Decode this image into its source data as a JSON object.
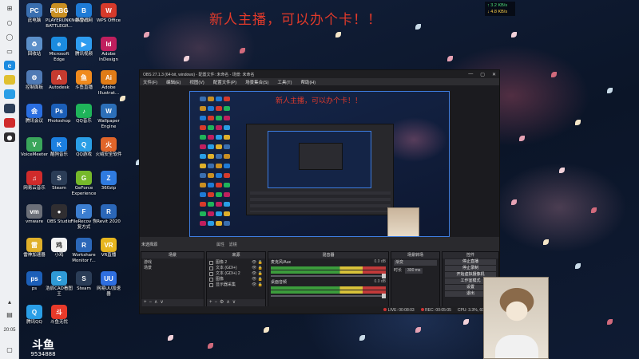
{
  "headline": "新人主播，可以办个卡！！",
  "net_speed": {
    "up": "↑ 3.2 KB/s",
    "down": "↓ 4.8 KB/s"
  },
  "taskbar": {
    "icons": [
      "windows-icon",
      "search-icon",
      "cortana-icon",
      "task-view-icon",
      "edge-icon",
      "chrome-icon",
      "qq-icon",
      "steam-icon",
      "netease-music-icon",
      "obs-icon"
    ],
    "clock": "20:05"
  },
  "desktop_icons": [
    {
      "label": "此电脑",
      "glyph": "PC",
      "color": "#3a6fb0"
    },
    {
      "label": "PLAYERUNKNOWN'S BATTLEGR...",
      "glyph": "PUBG",
      "color": "#c98f22"
    },
    {
      "label": "暴雪战网",
      "glyph": "B",
      "color": "#1e7bd6"
    },
    {
      "label": "WPS Office",
      "glyph": "W",
      "color": "#d63a2b"
    },
    {
      "label": "回收站",
      "glyph": "♻",
      "color": "#5b8fc9"
    },
    {
      "label": "Microsoft Edge",
      "glyph": "e",
      "color": "#1b8be0"
    },
    {
      "label": "腾讯视频",
      "glyph": "▶",
      "color": "#2e9cf0"
    },
    {
      "label": "Adobe InDesign",
      "glyph": "Id",
      "color": "#c01f5e"
    },
    {
      "label": "控制面板",
      "glyph": "⚙",
      "color": "#4f7ab5"
    },
    {
      "label": "Autodesk",
      "glyph": "A",
      "color": "#c63b2f"
    },
    {
      "label": "斗鱼直播",
      "glyph": "鱼",
      "color": "#f08a1d"
    },
    {
      "label": "Adobe Illustrat...",
      "glyph": "Ai",
      "color": "#e07c17"
    },
    {
      "label": "腾讯会议",
      "glyph": "会",
      "color": "#2a6ee0"
    },
    {
      "label": "Photoshop",
      "glyph": "Ps",
      "color": "#1c5fb8"
    },
    {
      "label": "QQ音乐",
      "glyph": "♪",
      "color": "#1fb45a"
    },
    {
      "label": "Wallpaper Engine",
      "glyph": "W",
      "color": "#2c6fb8"
    },
    {
      "label": "VoiceMeeter",
      "glyph": "V",
      "color": "#3aa65b"
    },
    {
      "label": "酷狗音乐",
      "glyph": "K",
      "color": "#1b7fe0"
    },
    {
      "label": "QQ游戏",
      "glyph": "Q",
      "color": "#2a9ee6"
    },
    {
      "label": "火绒安全软件",
      "glyph": "火",
      "color": "#e0652a"
    },
    {
      "label": "网易云音乐",
      "glyph": "♫",
      "color": "#d02b2b"
    },
    {
      "label": "Steam",
      "glyph": "S",
      "color": "#2b3d57"
    },
    {
      "label": "GeForce Experience",
      "glyph": "G",
      "color": "#76b82a"
    },
    {
      "label": "360zip",
      "glyph": "Z",
      "color": "#2f7be0"
    },
    {
      "label": "vmware",
      "glyph": "vm",
      "color": "#6b6f78"
    },
    {
      "label": "OBS Studio",
      "glyph": "●",
      "color": "#302e31"
    },
    {
      "label": "FileRecov 恢复方式",
      "glyph": "F",
      "color": "#3c7ed0"
    },
    {
      "label": "Revit 2020",
      "glyph": "R",
      "color": "#2b67b8"
    },
    {
      "label": "雷神加速器",
      "glyph": "雷",
      "color": "#e0b02a"
    },
    {
      "label": "小鸡",
      "glyph": "鸡",
      "color": "#f2f2f2"
    },
    {
      "label": "Workshare Monitor f...",
      "glyph": "R",
      "color": "#2b67b8"
    },
    {
      "label": "VR直播",
      "glyph": "VR",
      "color": "#e6b51e"
    },
    {
      "label": "ps",
      "glyph": "ps",
      "color": "#1c5fb8"
    },
    {
      "label": "浩辰CAD看图王",
      "glyph": "C",
      "color": "#2f9ad6"
    },
    {
      "label": "Steam",
      "glyph": "S",
      "color": "#2b3d57"
    },
    {
      "label": "网易UU加速器",
      "glyph": "UU",
      "color": "#2f6fe0"
    },
    {
      "label": "腾讯QQ",
      "glyph": "Q",
      "color": "#2a9ee6"
    },
    {
      "label": "斗鱼无忧",
      "glyph": "斗",
      "color": "#e83a2a"
    }
  ],
  "obs": {
    "title": "OBS 27.1.3 (64-bit, windows) - 配置文件: 未命名 - 场景: 未命名",
    "menu": [
      "文件(F)",
      "编辑(E)",
      "视图(V)",
      "配置文件(P)",
      "场景集合(S)",
      "工具(T)",
      "帮助(H)"
    ],
    "preview_headline": "新人主播，可以办个卡！！",
    "no_source_selected": "未选择源",
    "properties": "属性",
    "filters": "滤镜",
    "docks": {
      "scenes": {
        "title": "场景",
        "items": [
          "游戏",
          "场景"
        ]
      },
      "sources": {
        "title": "来源",
        "items": [
          {
            "name": "图像 2",
            "tail": "👁 🔒"
          },
          {
            "name": "文本 (GDI+)",
            "tail": "👁 🔒"
          },
          {
            "name": "文本 (GDI+) 2",
            "tail": "👁 🔒"
          },
          {
            "name": "图像",
            "tail": "👁 🔒"
          },
          {
            "name": "显示器采集",
            "tail": "👁 🔒"
          }
        ]
      },
      "mixer": {
        "title": "混音器",
        "channels": [
          {
            "name": "麦克风/Aux",
            "level": "0.0 dB"
          },
          {
            "name": "桌面音频",
            "level": "0.0 dB"
          }
        ]
      },
      "transitions": {
        "title": "场景转场",
        "type": "渐变",
        "duration_label": "时长",
        "duration": "300 ms"
      },
      "controls": {
        "title": "控件",
        "buttons": [
          "停止直播",
          "停止录制",
          "开始虚拟摄像机",
          "工作室模式",
          "设置",
          "退出"
        ]
      }
    },
    "status": {
      "live": "LIVE: 00:08:03",
      "rec": "REC: 00:05:05",
      "cpu": "CPU: 3.3%, 60.00 fps"
    }
  },
  "watermark": {
    "mark": "斗鱼",
    "room": "9534888"
  }
}
